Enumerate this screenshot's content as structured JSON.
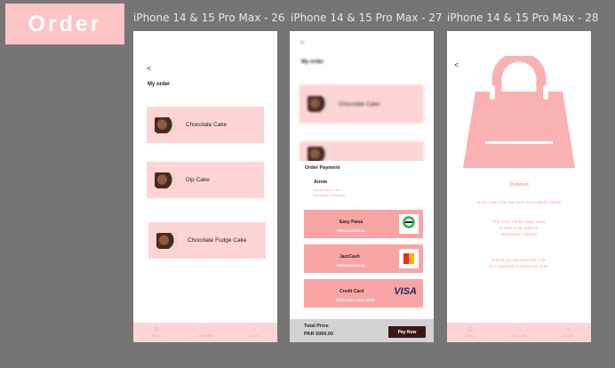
{
  "header": {
    "badge": "Order"
  },
  "frames": [
    {
      "label": "iPhone 14 & 15 Pro Max - 26"
    },
    {
      "label": "iPhone 14 & 15 Pro Max - 27"
    },
    {
      "label": "iPhone 14 & 15 Pro Max - 28"
    }
  ],
  "screen1": {
    "back": "<",
    "title": "My order",
    "items": [
      {
        "name": "Chocolate Cake"
      },
      {
        "name": "Dip Cake"
      },
      {
        "name": "Chocolate Fudge Cake"
      }
    ]
  },
  "tabs": [
    {
      "glyph": "☰",
      "label": "Menu"
    },
    {
      "glyph": "♡",
      "label": "Favourite"
    },
    {
      "glyph": "+",
      "label": "Order"
    }
  ],
  "screen2": {
    "back": "<",
    "title": "My order",
    "item": "Chocolate Cake",
    "sheet_title": "Order Payment",
    "customer_name": "Annie",
    "address_line1": "Sweet Shop Cafe",
    "address_line2": "Islamabad, Pakistan",
    "payments": [
      {
        "name": "Easy Paisa",
        "number": "+92xxxxxxxxxx",
        "logo": "easypaisa"
      },
      {
        "name": "JazzCash",
        "number": "+92xxxxxxxxxx",
        "logo": "jazzcash"
      },
      {
        "name": "Credit Card",
        "number": "2540 xxxx xxxx 2540",
        "logo": "VISA"
      }
    ],
    "total_label": "Total Price",
    "total_value": "PKR 5000.00",
    "pay_now": "Pay Now"
  },
  "screen3": {
    "back": "<",
    "status": "Ordered",
    "message1": "Annie, your order has been successfully placed.",
    "message2_line1": "The Order will be ready today",
    "message2_line2": "to 6:00 at the address",
    "message2_line3": "Islamabad, Pakistan",
    "message3_line1": "Submit your personal QR code",
    "message3_line2": "at a cakeshop to receive an order."
  },
  "colors": {
    "accent": "#fcc4c4",
    "card": "#fdd5d5",
    "pay": "#f9a5a5",
    "button": "#3a1616"
  }
}
